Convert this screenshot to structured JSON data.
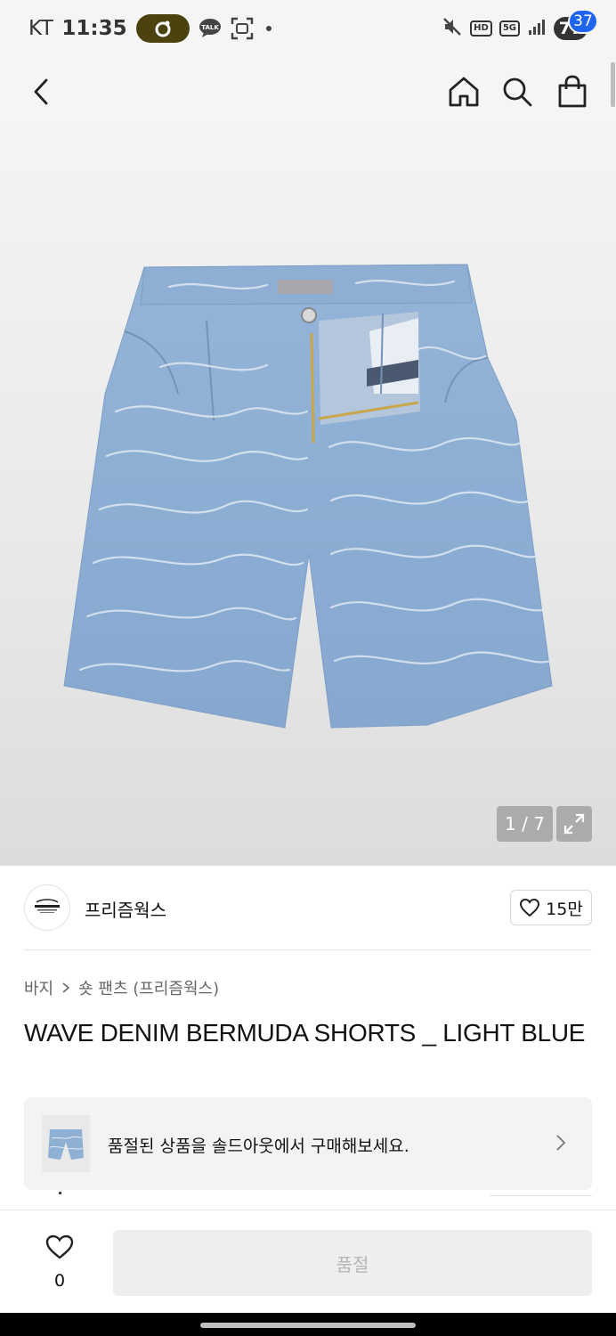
{
  "status_bar": {
    "carrier": "KT",
    "time": "11:35",
    "battery": "77",
    "network": "5G",
    "hd_label": "HD",
    "icons": [
      "notification-pill-icon",
      "talk-icon",
      "screenshot-icon",
      "mute-icon",
      "signal-icon",
      "battery-icon"
    ]
  },
  "header": {
    "cart_count": "37",
    "icons": [
      "back-icon",
      "home-icon",
      "search-icon",
      "cart-icon"
    ]
  },
  "gallery": {
    "counter": "1 / 7",
    "image_alt_icon": "denim-shorts-image"
  },
  "brand": {
    "name": "프리즘웍스",
    "like_count": "15만"
  },
  "breadcrumb": {
    "level1": "바지",
    "level2": "숏 팬츠 (프리즘웍스)"
  },
  "product": {
    "title": "WAVE DENIM BERMUDA SHORTS _ LIGHT BLUE"
  },
  "soldout_banner": {
    "text": "품절된 상품을 솔드아웃에서 구매해보세요."
  },
  "bottom_bar": {
    "wish_count": "0",
    "buy_label": "품절"
  },
  "colors": {
    "accent_badge": "#1e64f0",
    "denim": "#8fb1d6",
    "disabled_button": "#eeeeee"
  }
}
